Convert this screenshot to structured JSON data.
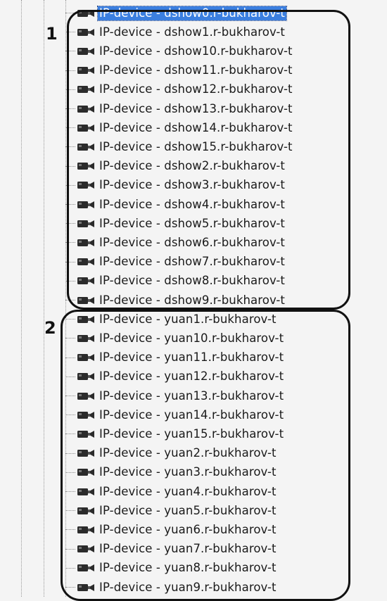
{
  "annotations": {
    "group1": "1",
    "group2": "2"
  },
  "devices": [
    {
      "label": "IP-device - dshow0.r-bukharov-t",
      "selected": true
    },
    {
      "label": "IP-device - dshow1.r-bukharov-t"
    },
    {
      "label": "IP-device - dshow10.r-bukharov-t"
    },
    {
      "label": "IP-device - dshow11.r-bukharov-t"
    },
    {
      "label": "IP-device - dshow12.r-bukharov-t"
    },
    {
      "label": "IP-device - dshow13.r-bukharov-t"
    },
    {
      "label": "IP-device - dshow14.r-bukharov-t"
    },
    {
      "label": "IP-device - dshow15.r-bukharov-t"
    },
    {
      "label": "IP-device - dshow2.r-bukharov-t"
    },
    {
      "label": "IP-device - dshow3.r-bukharov-t"
    },
    {
      "label": "IP-device - dshow4.r-bukharov-t"
    },
    {
      "label": "IP-device - dshow5.r-bukharov-t"
    },
    {
      "label": "IP-device - dshow6.r-bukharov-t"
    },
    {
      "label": "IP-device - dshow7.r-bukharov-t"
    },
    {
      "label": "IP-device - dshow8.r-bukharov-t"
    },
    {
      "label": "IP-device - dshow9.r-bukharov-t"
    },
    {
      "label": "IP-device - yuan1.r-bukharov-t"
    },
    {
      "label": "IP-device - yuan10.r-bukharov-t"
    },
    {
      "label": "IP-device - yuan11.r-bukharov-t"
    },
    {
      "label": "IP-device - yuan12.r-bukharov-t"
    },
    {
      "label": "IP-device - yuan13.r-bukharov-t"
    },
    {
      "label": "IP-device - yuan14.r-bukharov-t"
    },
    {
      "label": "IP-device - yuan15.r-bukharov-t"
    },
    {
      "label": "IP-device - yuan2.r-bukharov-t"
    },
    {
      "label": "IP-device - yuan3.r-bukharov-t"
    },
    {
      "label": "IP-device - yuan4.r-bukharov-t"
    },
    {
      "label": "IP-device - yuan5.r-bukharov-t"
    },
    {
      "label": "IP-device - yuan6.r-bukharov-t"
    },
    {
      "label": "IP-device - yuan7.r-bukharov-t"
    },
    {
      "label": "IP-device - yuan8.r-bukharov-t"
    },
    {
      "label": "IP-device - yuan9.r-bukharov-t"
    }
  ],
  "colors": {
    "selection": "#3b7fe0",
    "annotation": "#111111",
    "background": "#f4f4f4"
  },
  "icon": "camera-icon"
}
